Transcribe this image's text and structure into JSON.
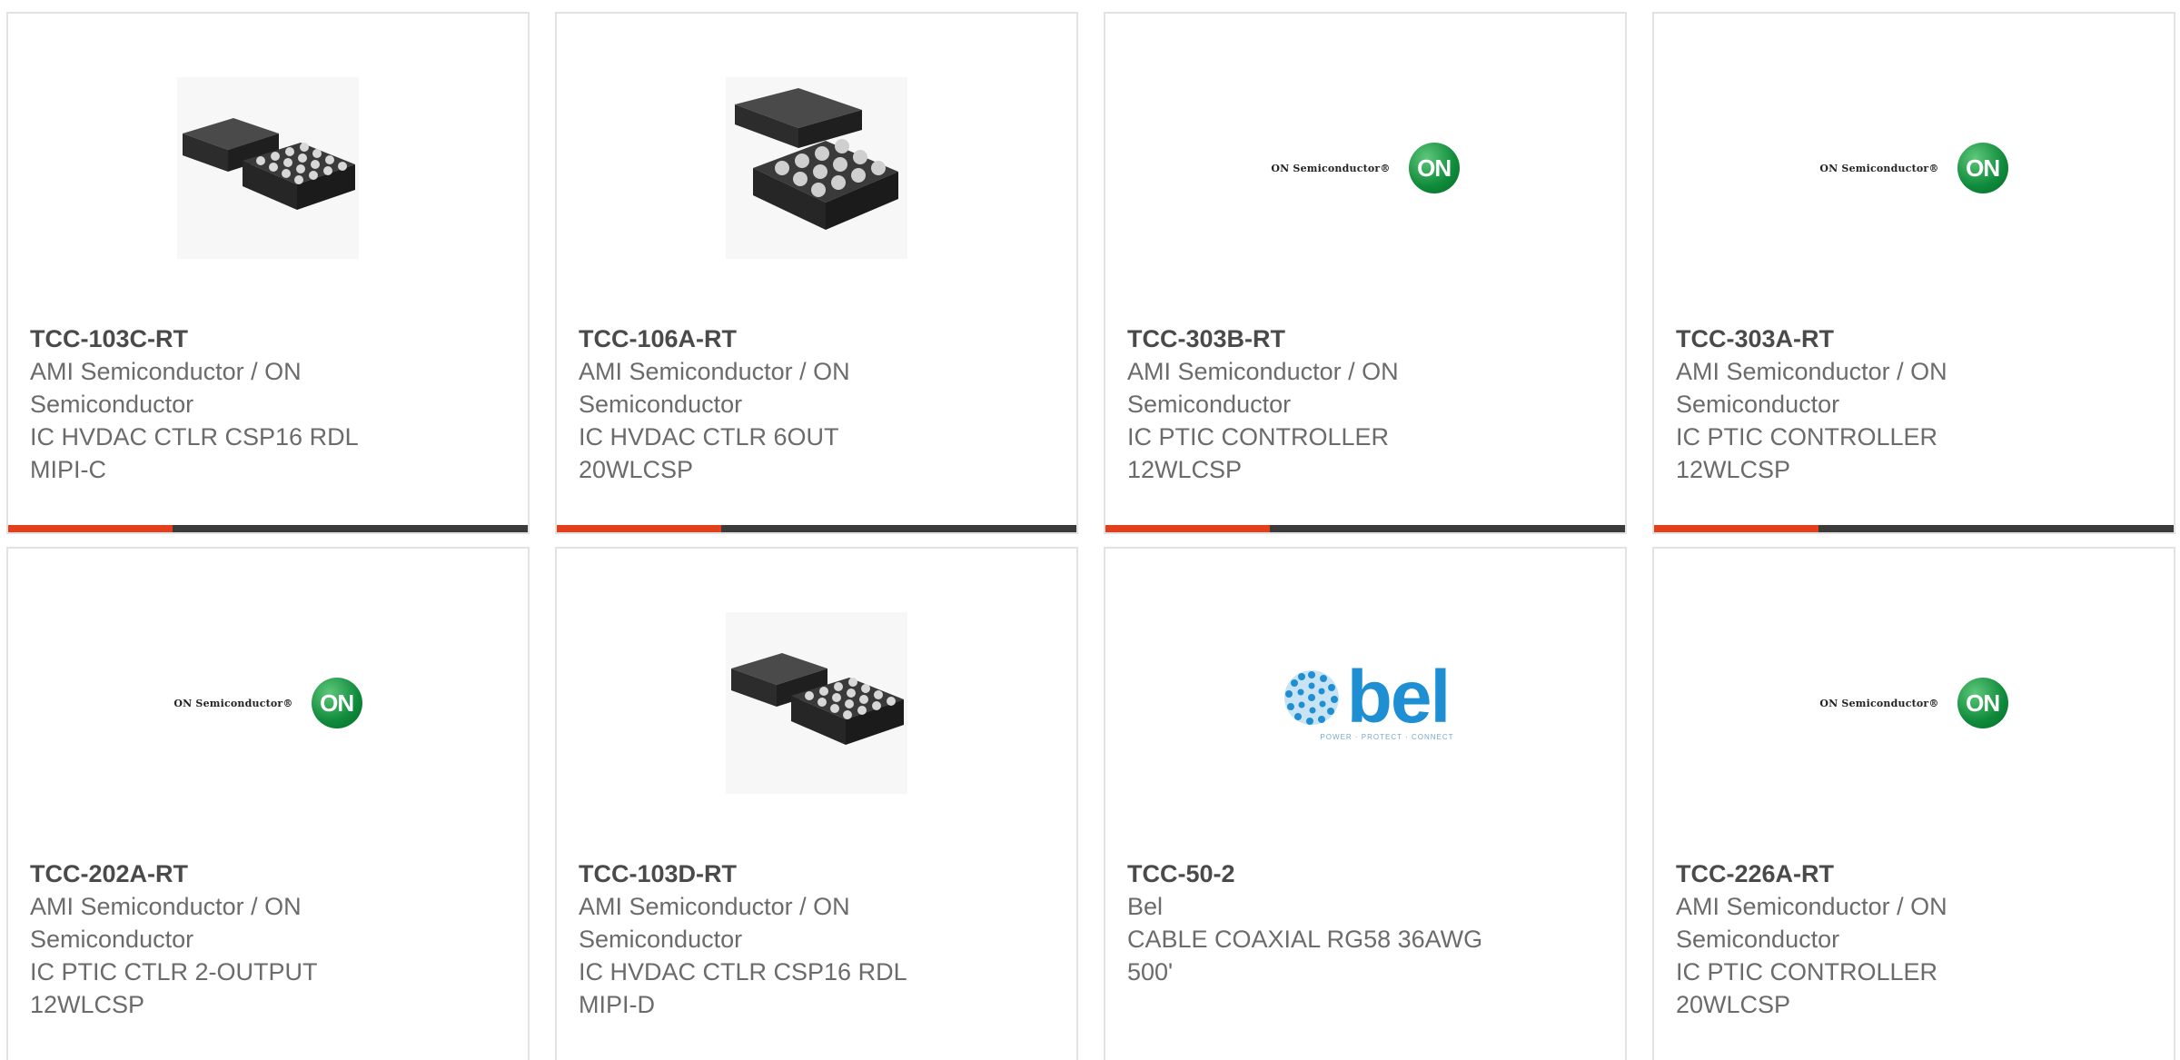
{
  "products": [
    {
      "part_number": "TCC-103C-RT",
      "manufacturer": "AMI Semiconductor / ON Semiconductor",
      "description": "IC HVDAC CTLR CSP16 RDL MIPI-C",
      "image": "chip-package-16-ball"
    },
    {
      "part_number": "TCC-106A-RT",
      "manufacturer": "AMI Semiconductor / ON Semiconductor",
      "description": "IC HVDAC CTLR 6OUT 20WLCSP",
      "image": "chip-package-12-ball"
    },
    {
      "part_number": "TCC-303B-RT",
      "manufacturer": "AMI Semiconductor / ON Semiconductor",
      "description": "IC PTIC CONTROLLER 12WLCSP",
      "image": "on-semiconductor-logo"
    },
    {
      "part_number": "TCC-303A-RT",
      "manufacturer": "AMI Semiconductor / ON Semiconductor",
      "description": "IC PTIC CONTROLLER 12WLCSP",
      "image": "on-semiconductor-logo"
    },
    {
      "part_number": "TCC-202A-RT",
      "manufacturer": "AMI Semiconductor / ON Semiconductor",
      "description": "IC PTIC CTLR 2-OUTPUT 12WLCSP",
      "image": "on-semiconductor-logo"
    },
    {
      "part_number": "TCC-103D-RT",
      "manufacturer": "AMI Semiconductor / ON Semiconductor",
      "description": "IC HVDAC CTLR CSP16 RDL MIPI-D",
      "image": "chip-package-16-ball"
    },
    {
      "part_number": "TCC-50-2",
      "manufacturer": "Bel",
      "description": "CABLE COAXIAL RG58 36AWG 500'",
      "image": "bel-logo"
    },
    {
      "part_number": "TCC-226A-RT",
      "manufacturer": "AMI Semiconductor / ON Semiconductor",
      "description": "IC PTIC CONTROLLER 20WLCSP",
      "image": "on-semiconductor-logo"
    }
  ],
  "logos": {
    "on_word": "ON Semiconductor®",
    "on_mark": "ON",
    "bel_word": "bel",
    "bel_tag": "POWER · PROTECT · CONNECT"
  },
  "colors": {
    "accent": "#e2401c",
    "bar": "#3b3b3b",
    "on_green": "#0e8a3a",
    "bel_blue": "#1e8fd3"
  }
}
